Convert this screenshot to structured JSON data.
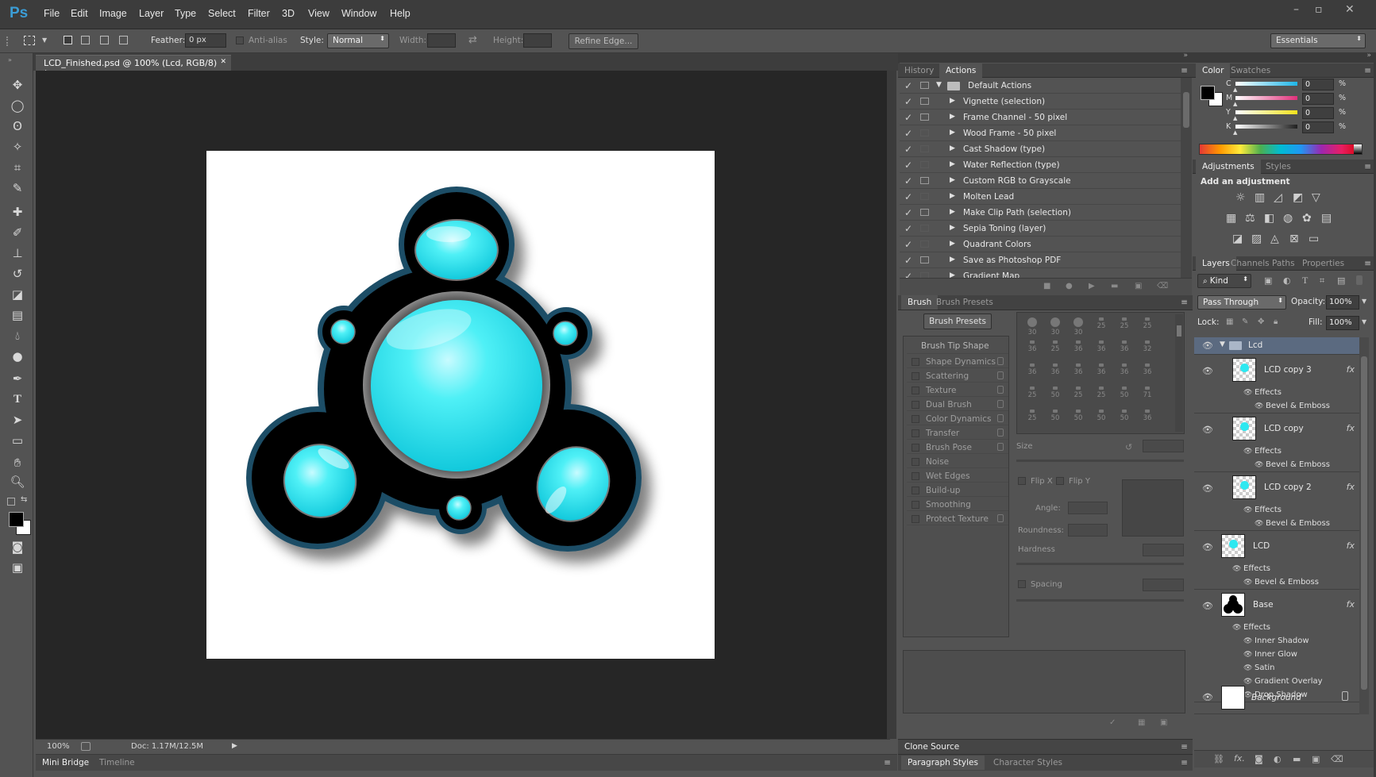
{
  "app": {
    "logo": "Ps"
  },
  "menu": [
    "File",
    "Edit",
    "Image",
    "Layer",
    "Type",
    "Select",
    "Filter",
    "3D",
    "View",
    "Window",
    "Help"
  ],
  "window_controls": [
    "minimize-icon",
    "restore-icon",
    "close-icon"
  ],
  "options_bar": {
    "feather_label": "Feather:",
    "feather_value": "0 px",
    "antialias_label": "Anti-alias",
    "style_label": "Style:",
    "style_value": "Normal",
    "width_label": "Width:",
    "height_label": "Height:",
    "refine_edge_label": "Refine Edge...",
    "workspace": "Essentials"
  },
  "document": {
    "tab_title": "LCD_Finished.psd @ 100% (Lcd, RGB/8) *",
    "zoom": "100%",
    "doc_info": "Doc: 1.17M/12.5M"
  },
  "bottom_tabs": [
    "Mini Bridge",
    "Timeline"
  ],
  "history_panel": {
    "tabs": [
      "History",
      "Actions"
    ],
    "active_tab": "Actions",
    "set_name": "Default Actions",
    "actions": [
      {
        "name": "Vignette (selection)",
        "dialog": true
      },
      {
        "name": "Frame Channel - 50 pixel",
        "dialog": true
      },
      {
        "name": "Wood Frame - 50 pixel",
        "dialog": false
      },
      {
        "name": "Cast Shadow (type)",
        "dialog": false
      },
      {
        "name": "Water Reflection (type)",
        "dialog": false
      },
      {
        "name": "Custom RGB to Grayscale",
        "dialog": true
      },
      {
        "name": "Molten Lead",
        "dialog": false
      },
      {
        "name": "Make Clip Path (selection)",
        "dialog": true
      },
      {
        "name": "Sepia Toning (layer)",
        "dialog": false
      },
      {
        "name": "Quadrant Colors",
        "dialog": false
      },
      {
        "name": "Save as Photoshop PDF",
        "dialog": true
      },
      {
        "name": "Gradient Map",
        "dialog": false
      }
    ]
  },
  "brush_panel": {
    "tabs": [
      "Brush",
      "Brush Presets"
    ],
    "presets_button": "Brush Presets",
    "tip_shape": "Brush Tip Shape",
    "options": [
      "Shape Dynamics",
      "Scattering",
      "Texture",
      "Dual Brush",
      "Color Dynamics",
      "Transfer",
      "Brush Pose",
      "Noise",
      "Wet Edges",
      "Build-up",
      "Smoothing",
      "Protect Texture"
    ],
    "tip_sizes": [
      "30",
      "30",
      "30",
      "25",
      "25",
      "25",
      "36",
      "25",
      "36",
      "36",
      "36",
      "32",
      "36",
      "36",
      "36",
      "36",
      "36",
      "36",
      "25",
      "50",
      "25",
      "25",
      "50",
      "71",
      "25",
      "50",
      "50",
      "50",
      "50",
      "36"
    ],
    "size_label": "Size",
    "flip_x": "Flip X",
    "flip_y": "Flip Y",
    "angle_label": "Angle:",
    "roundness_label": "Roundness:",
    "hardness_label": "Hardness",
    "spacing_label": "Spacing"
  },
  "lower_tabs": {
    "clone_source": "Clone Source",
    "paragraph_styles": "Paragraph Styles",
    "character_styles": "Character Styles"
  },
  "color_panel": {
    "tabs": [
      "Color",
      "Swatches"
    ],
    "channels": [
      {
        "label": "C",
        "value": "0",
        "color": "#1eb6e8"
      },
      {
        "label": "M",
        "value": "0",
        "color": "#e0307a"
      },
      {
        "label": "Y",
        "value": "0",
        "color": "#f2e21c"
      },
      {
        "label": "K",
        "value": "0",
        "color": "#202020"
      }
    ],
    "unit": "%"
  },
  "adjustments_panel": {
    "tabs": [
      "Adjustments",
      "Styles"
    ],
    "heading": "Add an adjustment"
  },
  "layers_panel": {
    "tabs": [
      "Layers",
      "Channels",
      "Paths",
      "Properties"
    ],
    "filter_kind": "Kind",
    "blend_mode": "Pass Through",
    "opacity_label": "Opacity:",
    "opacity_value": "100%",
    "lock_label": "Lock:",
    "fill_label": "Fill:",
    "fill_value": "100%",
    "group_name": "Lcd",
    "layers": [
      {
        "name": "LCD copy 3",
        "effects_label": "Effects",
        "effects": [
          "Bevel & Emboss"
        ]
      },
      {
        "name": "LCD copy",
        "effects_label": "Effects",
        "effects": [
          "Bevel & Emboss"
        ]
      },
      {
        "name": "LCD copy 2",
        "effects_label": "Effects",
        "effects": [
          "Bevel & Emboss"
        ]
      },
      {
        "name": "LCD",
        "effects_label": "Effects",
        "effects": [
          "Bevel & Emboss"
        ]
      },
      {
        "name": "Base",
        "effects_label": "Effects",
        "effects": [
          "Inner Shadow",
          "Inner Glow",
          "Satin",
          "Gradient Overlay",
          "Drop Shadow"
        ]
      }
    ],
    "background_name": "Background",
    "fx_symbol": "fx"
  },
  "colors": {
    "accent_cyan": "#2ee8f0",
    "panel_bg": "#535353",
    "doc_bg": "#262626"
  }
}
